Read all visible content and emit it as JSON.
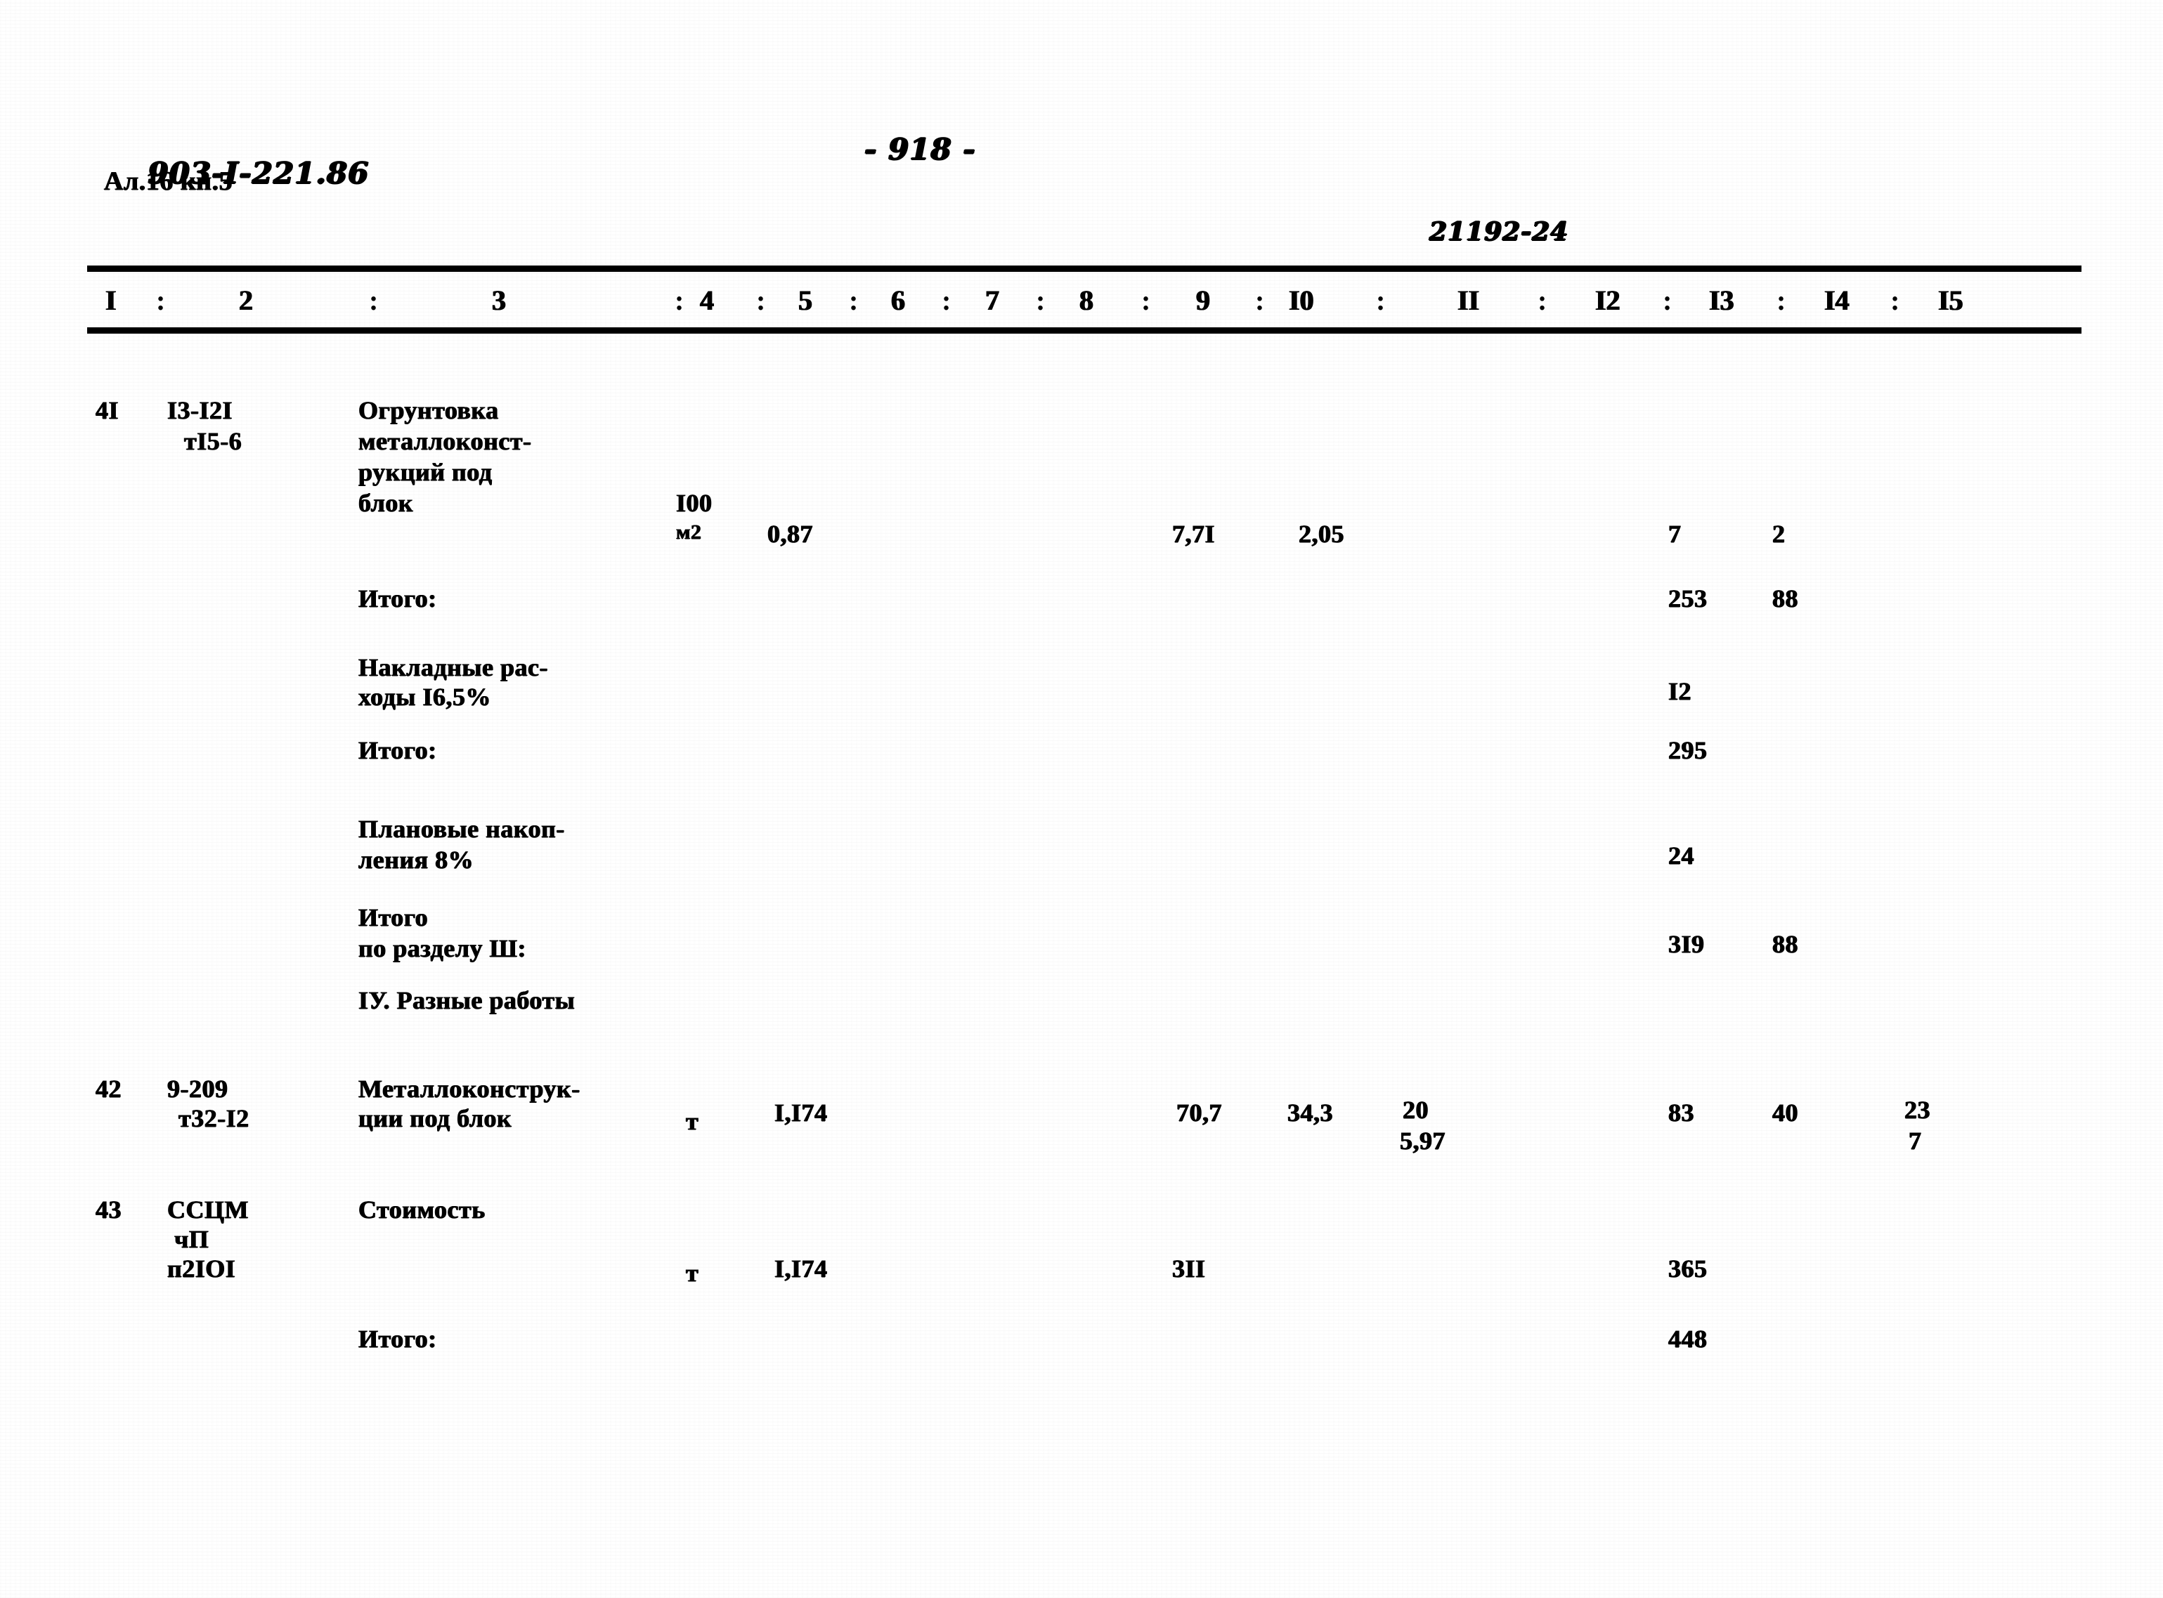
{
  "header": {
    "doc_code_printed": "903-I-",
    "doc_code_hand": "221.86",
    "album_line": "Ал.16 кн.5",
    "page_marker": "- 918 -",
    "sheet_code": "21192-24"
  },
  "table": {
    "column_headers": [
      "I",
      "2",
      "3",
      "4",
      "5",
      "6",
      "7",
      "8",
      "9",
      "I0",
      "II",
      "I2",
      "I3",
      "I4",
      "I5"
    ],
    "column_separator": ":",
    "rows": [
      {
        "kind": "position",
        "pos": "4I",
        "code_line1": "I3-I2I",
        "code_line2": "тI5-6",
        "description": [
          "Огрунтовка",
          "металлоконст-",
          "рукций под",
          "блок"
        ],
        "unit_line1": "I00",
        "unit_line2": "м2",
        "c5": "0,87",
        "c8": "7,7I",
        "c9": "2,05",
        "c12": "7",
        "c13": "2"
      },
      {
        "kind": "subtotal",
        "label": "Итого:",
        "c12": "253",
        "c13": "88"
      },
      {
        "kind": "subtotal",
        "label_line1": "Накладные рас-",
        "label_line2": "ходы I6,5%",
        "c12": "I2"
      },
      {
        "kind": "subtotal",
        "label": "Итого:",
        "c12": "295"
      },
      {
        "kind": "subtotal",
        "label_line1": "Плановые накоп-",
        "label_line2": "ления 8%",
        "c12": "24"
      },
      {
        "kind": "subtotal",
        "label_line1": "Итого",
        "label_line2": "по разделу Ш:",
        "c12": "3I9",
        "c13": "88"
      },
      {
        "kind": "section",
        "label": "IУ. Разные работы"
      },
      {
        "kind": "position",
        "pos": "42",
        "code_line1": "9-209",
        "code_line2": "т32-I2",
        "description": [
          "Металлоконструк-",
          "ции под блок"
        ],
        "unit_line1": "т",
        "c5": "I,I74",
        "c8": "70,7",
        "c9": "34,3",
        "c10_top": "20",
        "c10_bottom": "5,97",
        "c12": "83",
        "c13": "40",
        "c14_top": "23",
        "c14_bottom": "7"
      },
      {
        "kind": "position",
        "pos": "43",
        "code_line1": "ССЦМ",
        "code_line2": "чП",
        "code_line3": "п2IOI",
        "description": [
          "Стоимость"
        ],
        "unit_line1": "т",
        "c5": "I,I74",
        "c8": "3II",
        "c12": "365"
      },
      {
        "kind": "subtotal",
        "label": "Итого:",
        "c12": "448"
      }
    ]
  }
}
